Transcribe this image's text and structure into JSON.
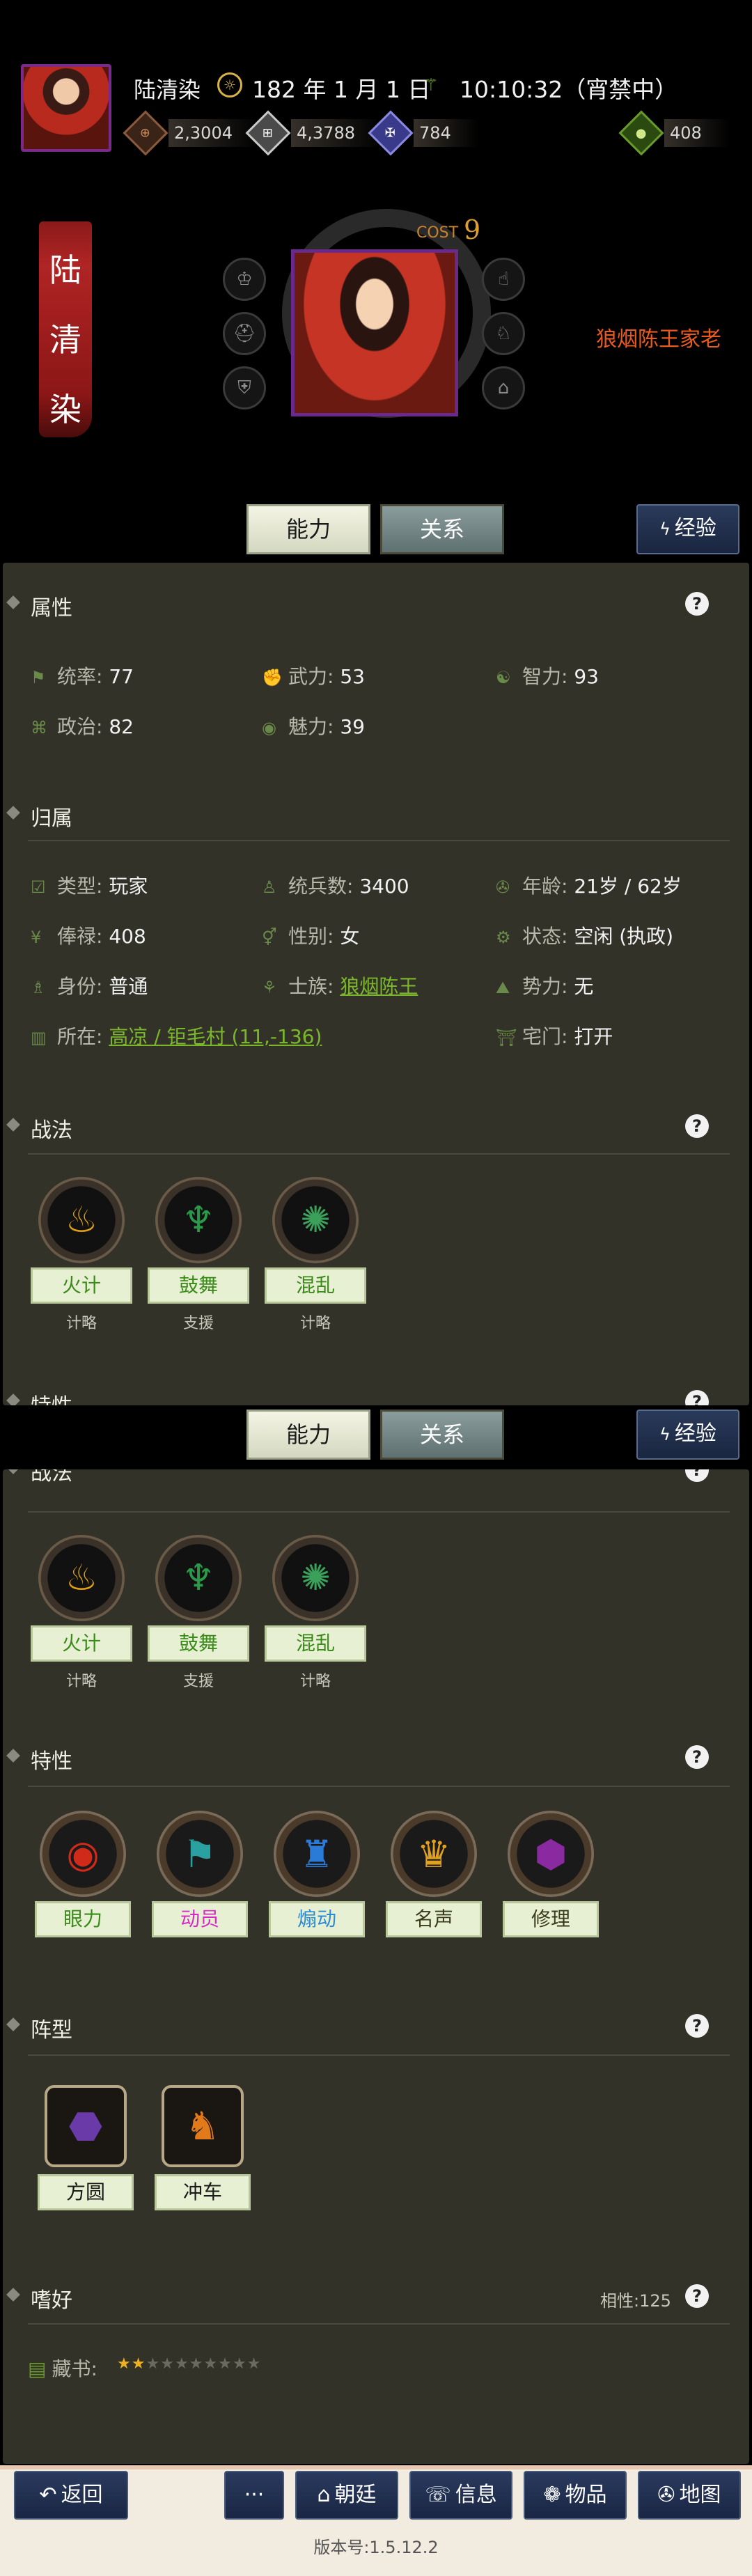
{
  "header": {
    "name": "陆清染",
    "date": "182 年 1 月 1 日",
    "time": "10:10:32（宵禁中）",
    "resources": [
      {
        "icon": "bronze-coin-icon",
        "value": "2,3004",
        "color": "#7a4a2a"
      },
      {
        "icon": "silver-coin-icon",
        "value": "4,3788",
        "color": "#b8b8b8"
      },
      {
        "icon": "token-icon",
        "value": "784",
        "color": "#6a6ac8"
      },
      {
        "icon": "jade-icon",
        "value": "408",
        "color": "#6a9a2a"
      }
    ]
  },
  "profile": {
    "banner_name": "陆\n清\n染",
    "banner_chars": [
      "陆",
      "清",
      "染"
    ],
    "cost_label": "COST",
    "cost_value": "9",
    "family_title": "狼烟陈王家老"
  },
  "tabs": {
    "ability": "能力",
    "relation": "关系",
    "exp": "经验"
  },
  "attributes": {
    "title": "属性",
    "items": [
      {
        "label": "统率:",
        "value": "77"
      },
      {
        "label": "武力:",
        "value": "53"
      },
      {
        "label": "智力:",
        "value": "93"
      },
      {
        "label": "政治:",
        "value": "82"
      },
      {
        "label": "魅力:",
        "value": "39"
      }
    ]
  },
  "belonging": {
    "title": "归属",
    "type": {
      "label": "类型:",
      "value": "玩家"
    },
    "troops": {
      "label": "统兵数:",
      "value": "3400"
    },
    "age": {
      "label": "年龄:",
      "value": "21岁 / 62岁"
    },
    "salary": {
      "label": "俸禄:",
      "value": "408"
    },
    "gender": {
      "label": "性别:",
      "value": "女"
    },
    "status": {
      "label": "状态:",
      "value": "空闲 (执政)"
    },
    "identity": {
      "label": "身份:",
      "value": "普通"
    },
    "clan": {
      "label": "士族:",
      "value": "狼烟陈王"
    },
    "faction": {
      "label": "势力:",
      "value": "无"
    },
    "location": {
      "label": "所在:",
      "value": "高凉 / 钜毛村 (11,-136)"
    },
    "residence": {
      "label": "宅门:",
      "value": "打开"
    }
  },
  "tactics": {
    "title": "战法",
    "items": [
      {
        "name": "火计",
        "type": "计略",
        "color": "#e0a010",
        "glyph": "♨"
      },
      {
        "name": "鼓舞",
        "type": "支援",
        "color": "#2a9a4a",
        "glyph": "♆"
      },
      {
        "name": "混乱",
        "type": "计略",
        "color": "#3aa05a",
        "glyph": "✺"
      }
    ]
  },
  "traits": {
    "title": "特性",
    "items": [
      {
        "name": "眼力",
        "color": "#3a8a1a",
        "glyph": "◉",
        "icon_color": "#d02a1a"
      },
      {
        "name": "动员",
        "color": "#d82ac8",
        "glyph": "⚑",
        "icon_color": "#2aa0a0"
      },
      {
        "name": "煽动",
        "color": "#2a8ad8",
        "glyph": "♜",
        "icon_color": "#2a7ad8"
      },
      {
        "name": "名声",
        "color": "#3a3a1a",
        "glyph": "♛",
        "icon_color": "#e0a020"
      },
      {
        "name": "修理",
        "color": "#3a3a1a",
        "glyph": "⬢",
        "icon_color": "#8a2aa0"
      }
    ]
  },
  "formation": {
    "title": "阵型",
    "items": [
      {
        "name": "方圆",
        "glyph": "⬣",
        "icon_color": "#6a3aa8"
      },
      {
        "name": "冲车",
        "glyph": "♞",
        "icon_color": "#e07a1a"
      }
    ]
  },
  "hobby": {
    "title": "嗜好",
    "affinity": "相性:125",
    "item_label": "藏书:",
    "stars_filled": 2,
    "stars_total": 10
  },
  "bottom_nav": {
    "back": "返回",
    "more": "···",
    "court": "朝廷",
    "info": "信息",
    "items": "物品",
    "map": "地图",
    "version": "版本号:1.5.12.2"
  }
}
